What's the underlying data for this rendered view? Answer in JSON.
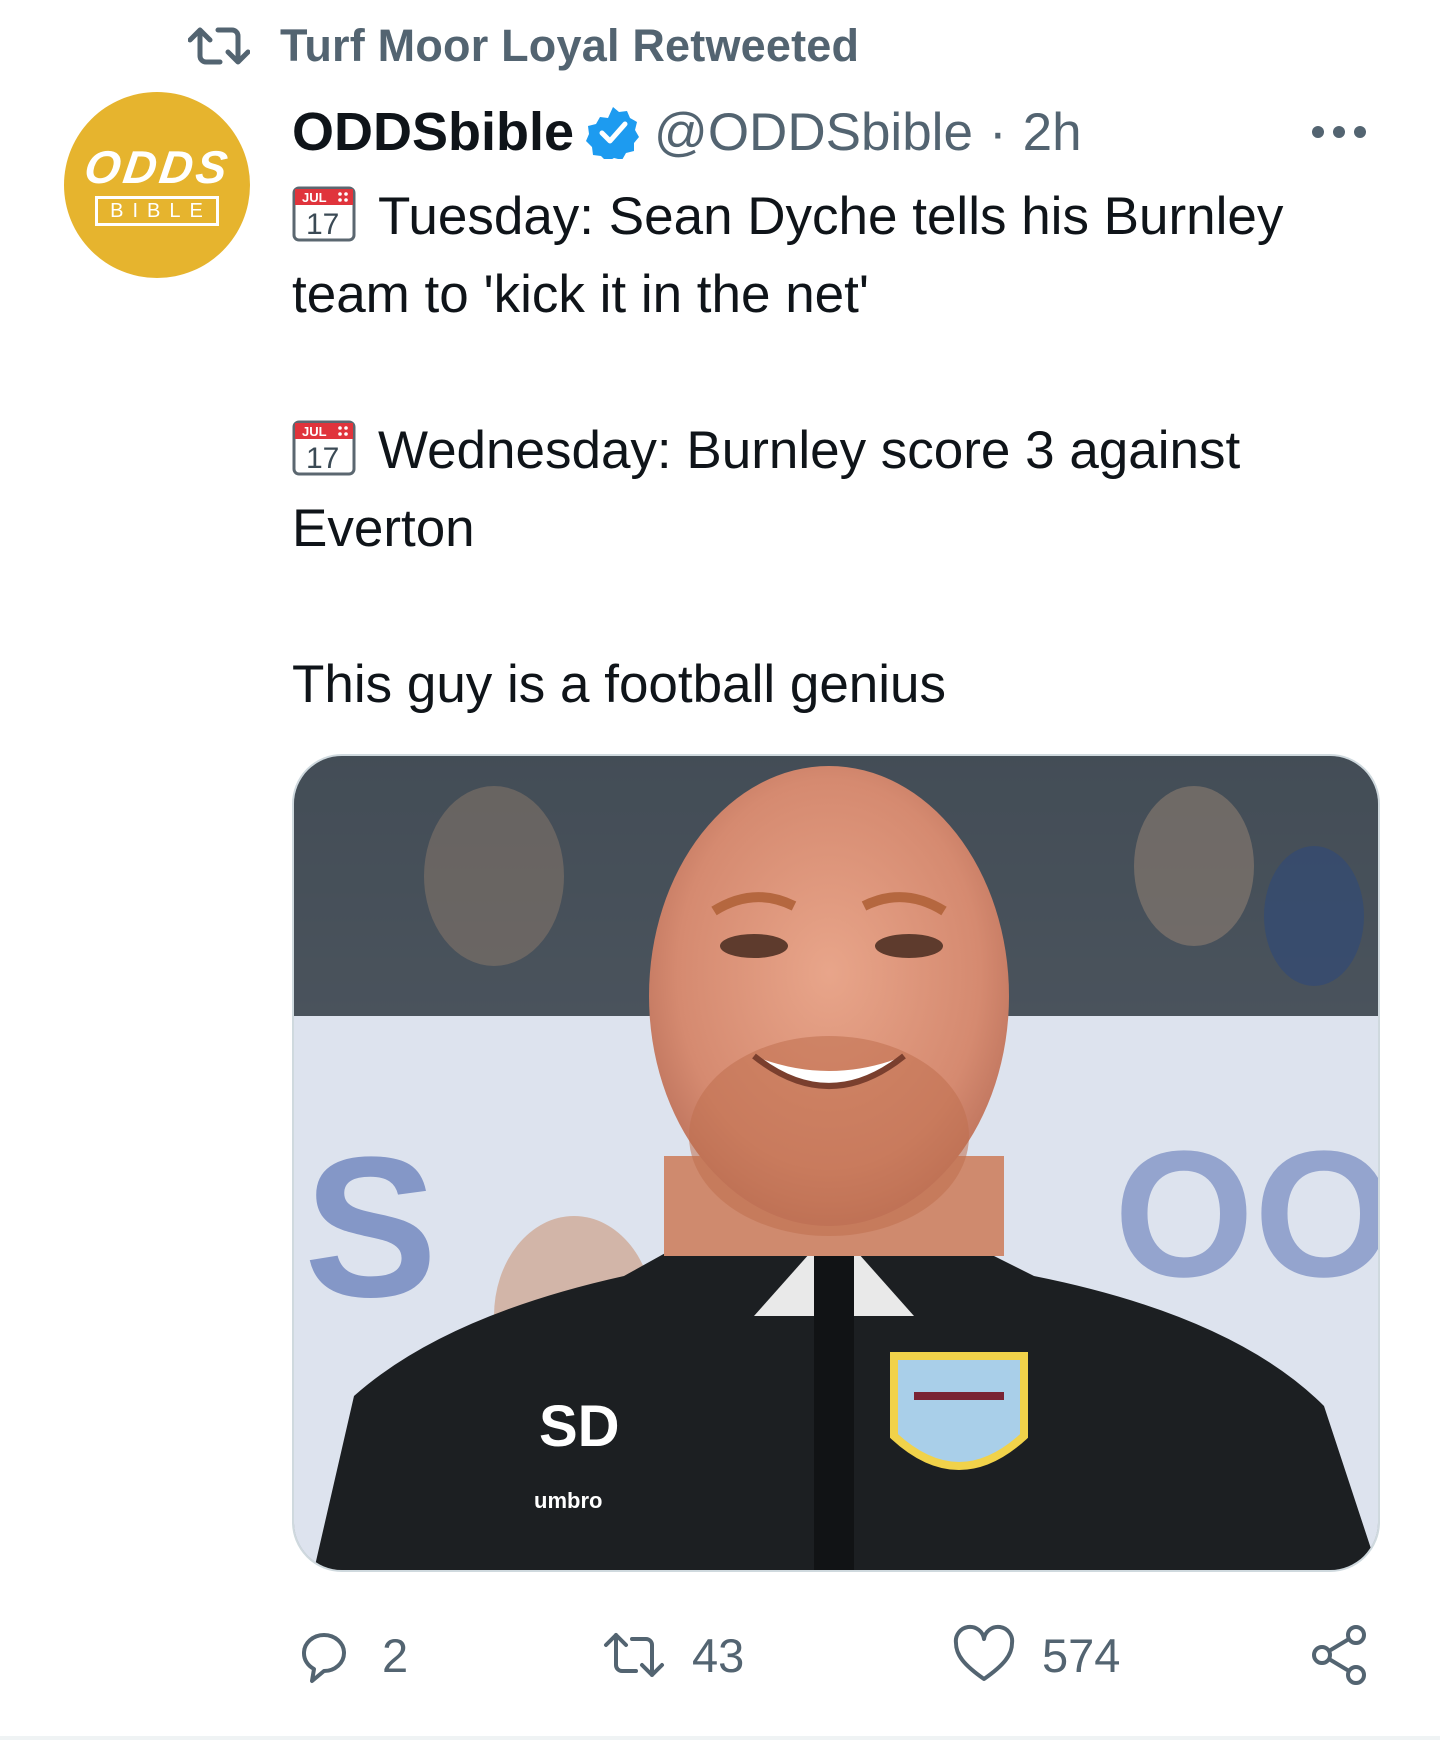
{
  "retweet_banner": {
    "text": "Turf Moor Loyal Retweeted",
    "icon": "retweet-icon"
  },
  "author": {
    "display_name": "ODDSbible",
    "handle": "@ODDSbible",
    "separator": "·",
    "time_ago": "2h",
    "verified": true,
    "avatar_text_top": "ODDS",
    "avatar_text_bottom": "BIBLE",
    "avatar_color": "#e6b42e"
  },
  "tweet": {
    "calendar_icon": {
      "month": "JUL",
      "day": "17"
    },
    "lines": [
      "Tuesday: Sean Dyche tells his Burnley team to 'kick it in the net'",
      "Wednesday: Burnley score 3 against Everton",
      "This guy is a football genius"
    ]
  },
  "media": {
    "alt": "",
    "jacket_initials": "SD",
    "jacket_brand": "umbro"
  },
  "actions": {
    "reply": {
      "icon": "reply-icon",
      "count": "2"
    },
    "retweet": {
      "icon": "retweet-icon",
      "count": "43"
    },
    "like": {
      "icon": "heart-icon",
      "count": "574"
    },
    "share": {
      "icon": "share-icon"
    }
  },
  "colors": {
    "secondary_text": "#536471",
    "primary_text": "#0f1419",
    "verified_blue": "#1d9bf0",
    "calendar_red": "#e0343c"
  }
}
